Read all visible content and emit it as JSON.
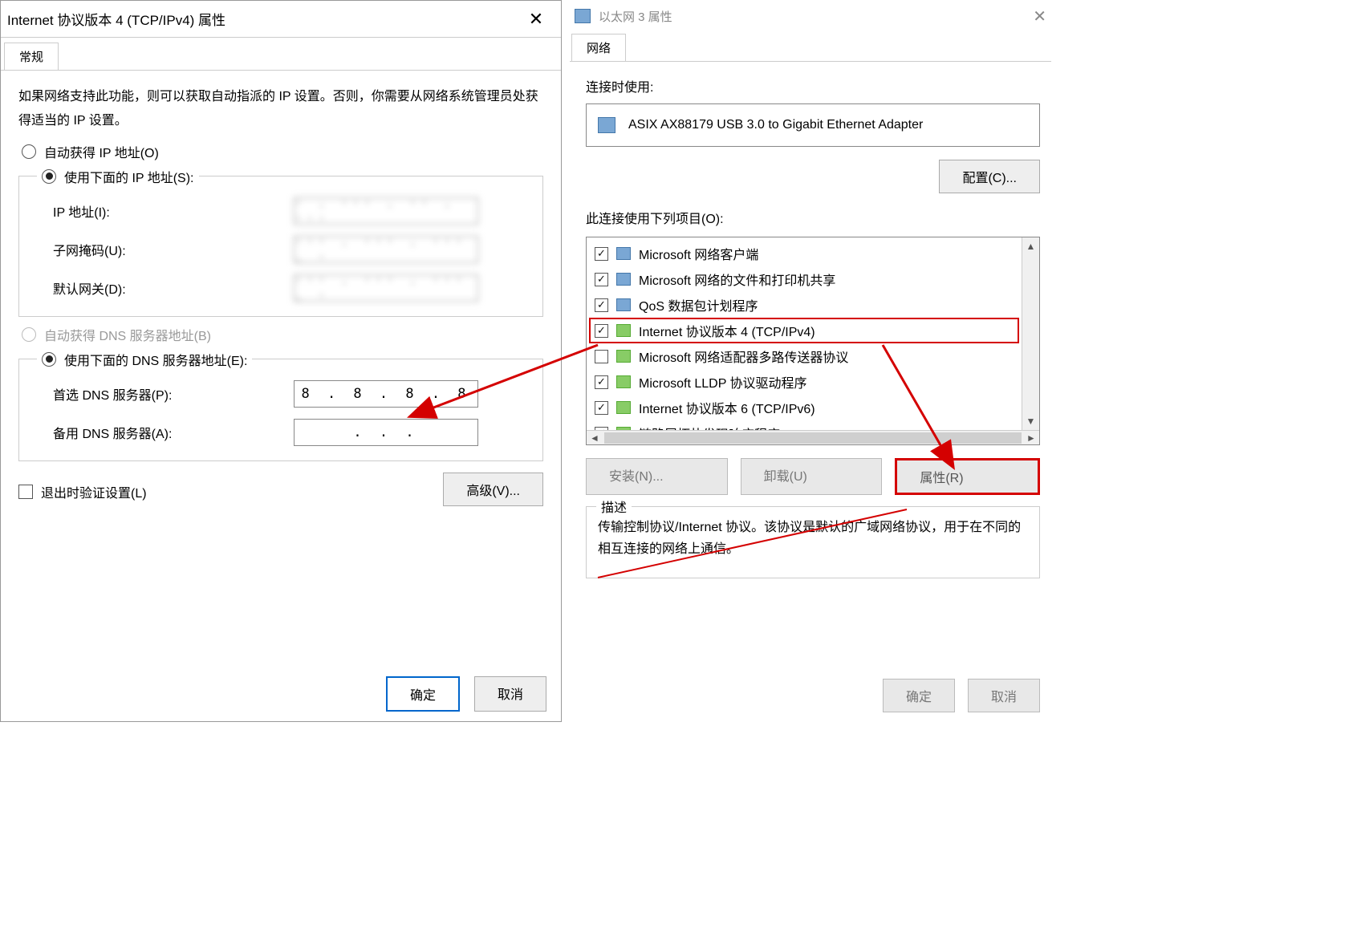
{
  "left": {
    "title": "Internet 协议版本 4 (TCP/IPv4) 属性",
    "tab_general": "常规",
    "info": "如果网络支持此功能，则可以获取自动指派的 IP 设置。否则，你需要从网络系统管理员处获得适当的 IP 设置。",
    "radio_auto_ip": "自动获得 IP 地址(O)",
    "radio_static_ip": "使用下面的 IP 地址(S):",
    "lbl_ip": "IP 地址(I):",
    "lbl_mask": "子网掩码(U):",
    "lbl_gw": "默认网关(D):",
    "val_ip": "· . ··· . ·· . ···",
    "val_mask": "··· . ··· . ··· . ·",
    "val_gw": "··· . ··· . ··· . ·",
    "radio_auto_dns": "自动获得 DNS 服务器地址(B)",
    "radio_static_dns": "使用下面的 DNS 服务器地址(E):",
    "lbl_dns1": "首选 DNS 服务器(P):",
    "lbl_dns2": "备用 DNS 服务器(A):",
    "val_dns1": "8 . 8 . 8 . 8",
    "val_dns2": ".   .   .",
    "chk_validate": "退出时验证设置(L)",
    "btn_advanced": "高级(V)...",
    "btn_ok": "确定",
    "btn_cancel": "取消"
  },
  "right": {
    "title": "以太网 3 属性",
    "tab_network": "网络",
    "lbl_connect_using": "连接时使用:",
    "adapter": "ASIX AX88179 USB 3.0 to Gigabit Ethernet Adapter",
    "btn_configure": "配置(C)...",
    "lbl_items": "此连接使用下列项目(O):",
    "items": [
      {
        "checked": true,
        "icon": "blue",
        "label": "Microsoft 网络客户端"
      },
      {
        "checked": true,
        "icon": "blue",
        "label": "Microsoft 网络的文件和打印机共享"
      },
      {
        "checked": true,
        "icon": "blue",
        "label": "QoS 数据包计划程序"
      },
      {
        "checked": true,
        "icon": "grn",
        "label": "Internet 协议版本 4 (TCP/IPv4)",
        "highlight": true
      },
      {
        "checked": false,
        "icon": "grn",
        "label": "Microsoft 网络适配器多路传送器协议"
      },
      {
        "checked": true,
        "icon": "grn",
        "label": "Microsoft LLDP 协议驱动程序"
      },
      {
        "checked": true,
        "icon": "grn",
        "label": "Internet 协议版本 6 (TCP/IPv6)"
      },
      {
        "checked": true,
        "icon": "grn",
        "label": "链路层拓扑发现响应程序"
      }
    ],
    "btn_install": "安装(N)...",
    "btn_uninstall": "卸载(U)",
    "btn_properties": "属性(R)",
    "desc_legend": "描述",
    "desc_text": "传输控制协议/Internet 协议。该协议是默认的广域网络协议，用于在不同的相互连接的网络上通信。",
    "btn_ok": "确定",
    "btn_cancel": "取消"
  }
}
